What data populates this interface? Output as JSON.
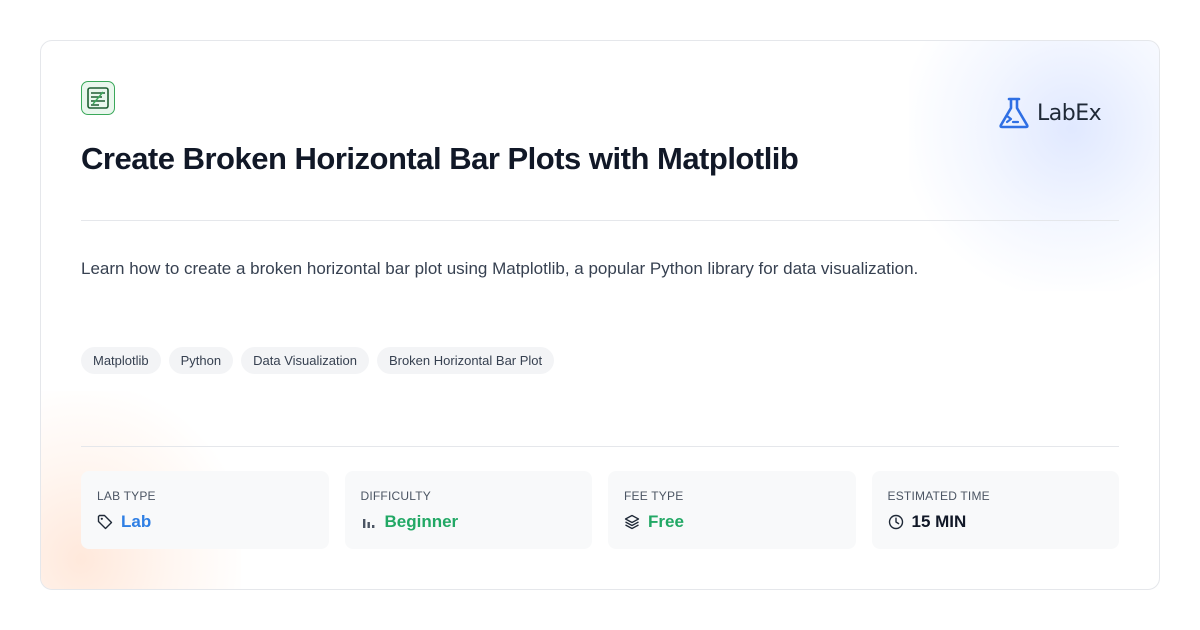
{
  "title": "Create Broken Horizontal Bar Plots with Matplotlib",
  "description": "Learn how to create a broken horizontal bar plot using Matplotlib, a popular Python library for data visualization.",
  "logo": {
    "text": "LabEx",
    "color": "#2f6fe4"
  },
  "tags": [
    "Matplotlib",
    "Python",
    "Data Visualization",
    "Broken Horizontal Bar Plot"
  ],
  "stats": [
    {
      "label": "LAB TYPE",
      "value": "Lab",
      "icon": "tag-icon",
      "color": "#2f7fe4"
    },
    {
      "label": "DIFFICULTY",
      "value": "Beginner",
      "icon": "bar-chart-icon",
      "color": "#22a865"
    },
    {
      "label": "FEE TYPE",
      "value": "Free",
      "icon": "layers-icon",
      "color": "#22a865"
    },
    {
      "label": "ESTIMATED TIME",
      "value": "15 MIN",
      "icon": "clock-icon",
      "color": "#111827"
    }
  ]
}
